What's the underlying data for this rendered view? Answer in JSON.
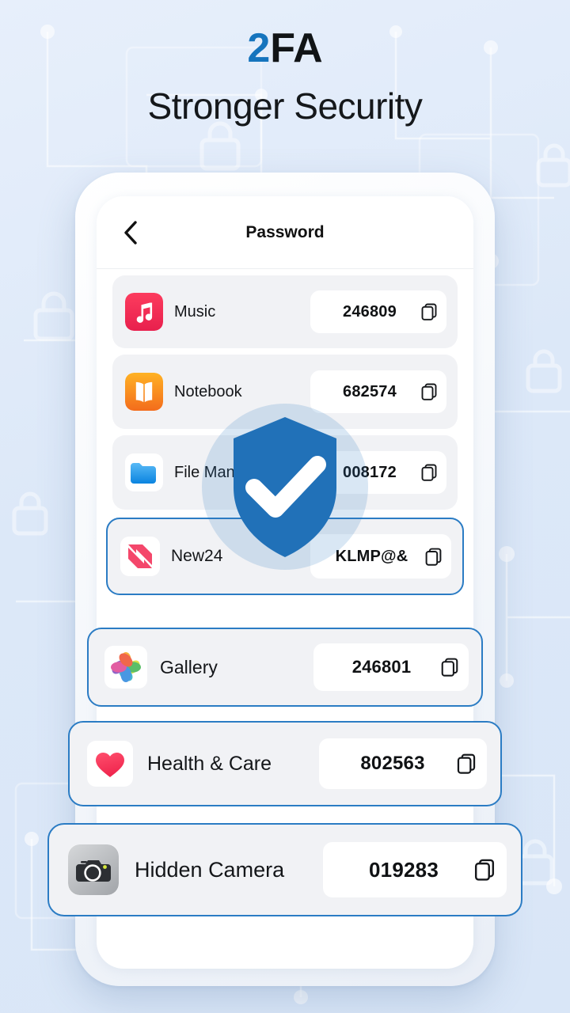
{
  "headline": {
    "title_accent": "2",
    "title_rest": "FA",
    "subtitle": "Stronger Security"
  },
  "colors": {
    "page_background": "#dce8f8",
    "accent_blue": "#1574bd",
    "shield_blue": "#2b7cc4",
    "card_background": "#f1f2f5",
    "card_border_blue": "#2b7cc4",
    "pill_background": "#ffffff",
    "text_primary": "#141619"
  },
  "phone": {
    "nav": {
      "back_icon": "chevron-left-icon",
      "title": "Password"
    },
    "rows": [
      {
        "app": "Music",
        "code": "246809",
        "icon": "music-note-icon",
        "copy_icon": "copy-icon",
        "highlighted": false
      },
      {
        "app": "Notebook",
        "code": "682574",
        "icon": "book-icon",
        "copy_icon": "copy-icon",
        "highlighted": false
      },
      {
        "app": "File Manager",
        "code": "008172",
        "icon": "folder-icon",
        "copy_icon": "copy-icon",
        "highlighted": false
      },
      {
        "app": "New24",
        "code": "KLMP@&",
        "icon": "news-icon",
        "copy_icon": "copy-icon",
        "highlighted": true
      },
      {
        "app": "Gallery",
        "code": "246801",
        "icon": "photos-icon",
        "copy_icon": "copy-icon",
        "highlighted": true
      },
      {
        "app": "Health & Care",
        "code": "802563",
        "icon": "heart-icon",
        "copy_icon": "copy-icon",
        "highlighted": true
      },
      {
        "app": "Hidden Camera",
        "code": "019283",
        "icon": "camera-icon",
        "copy_icon": "copy-icon",
        "highlighted": true
      }
    ]
  },
  "overlay": {
    "badge_icon": "shield-check-icon"
  }
}
